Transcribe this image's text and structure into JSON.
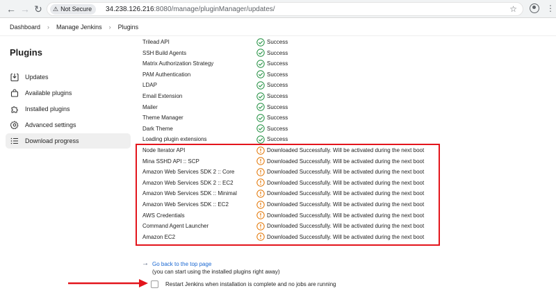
{
  "browser": {
    "security_label": "Not Secure",
    "url_host": "34.238.126.216",
    "url_path": ":8080/manage/pluginManager/updates/"
  },
  "breadcrumb": [
    "Dashboard",
    "Manage Jenkins",
    "Plugins"
  ],
  "sidebar": {
    "title": "Plugins",
    "items": [
      {
        "label": "Updates",
        "icon": "download-icon",
        "active": false
      },
      {
        "label": "Available plugins",
        "icon": "shopping-bag-icon",
        "active": false
      },
      {
        "label": "Installed plugins",
        "icon": "puzzle-icon",
        "active": false
      },
      {
        "label": "Advanced settings",
        "icon": "gear-icon",
        "active": false
      },
      {
        "label": "Download progress",
        "icon": "list-icon",
        "active": true
      }
    ]
  },
  "plugins": [
    {
      "name": "Trilead API",
      "status": "Success",
      "state": "success"
    },
    {
      "name": "SSH Build Agents",
      "status": "Success",
      "state": "success"
    },
    {
      "name": "Matrix Authorization Strategy",
      "status": "Success",
      "state": "success"
    },
    {
      "name": "PAM Authentication",
      "status": "Success",
      "state": "success"
    },
    {
      "name": "LDAP",
      "status": "Success",
      "state": "success"
    },
    {
      "name": "Email Extension",
      "status": "Success",
      "state": "success"
    },
    {
      "name": "Mailer",
      "status": "Success",
      "state": "success"
    },
    {
      "name": "Theme Manager",
      "status": "Success",
      "state": "success"
    },
    {
      "name": "Dark Theme",
      "status": "Success",
      "state": "success"
    },
    {
      "name": "Loading plugin extensions",
      "status": "Success",
      "state": "success"
    },
    {
      "name": "Node Iterator API",
      "status": "Downloaded Successfully. Will be activated during the next boot",
      "state": "pending"
    },
    {
      "name": "Mina SSHD API :: SCP",
      "status": "Downloaded Successfully. Will be activated during the next boot",
      "state": "pending"
    },
    {
      "name": "Amazon Web Services SDK 2 :: Core",
      "status": "Downloaded Successfully. Will be activated during the next boot",
      "state": "pending"
    },
    {
      "name": "Amazon Web Services SDK 2 :: EC2",
      "status": "Downloaded Successfully. Will be activated during the next boot",
      "state": "pending"
    },
    {
      "name": "Amazon Web Services SDK :: Minimal",
      "status": "Downloaded Successfully. Will be activated during the next boot",
      "state": "pending"
    },
    {
      "name": "Amazon Web Services SDK :: EC2",
      "status": "Downloaded Successfully. Will be activated during the next boot",
      "state": "pending"
    },
    {
      "name": "AWS Credentials",
      "status": "Downloaded Successfully. Will be activated during the next boot",
      "state": "pending"
    },
    {
      "name": "Command Agent Launcher",
      "status": "Downloaded Successfully. Will be activated during the next boot",
      "state": "pending"
    },
    {
      "name": "Amazon EC2",
      "status": "Downloaded Successfully. Will be activated during the next boot",
      "state": "pending"
    }
  ],
  "footer": {
    "back_link": "Go back to the top page",
    "note": "(you can start using the installed plugins right away)",
    "restart_label": "Restart Jenkins when installation is complete and no jobs are running",
    "restart_checked": false
  },
  "colors": {
    "success": "#1e8e3e",
    "pending": "#e37400",
    "highlight": "#e3141b",
    "link": "#1967d2"
  }
}
